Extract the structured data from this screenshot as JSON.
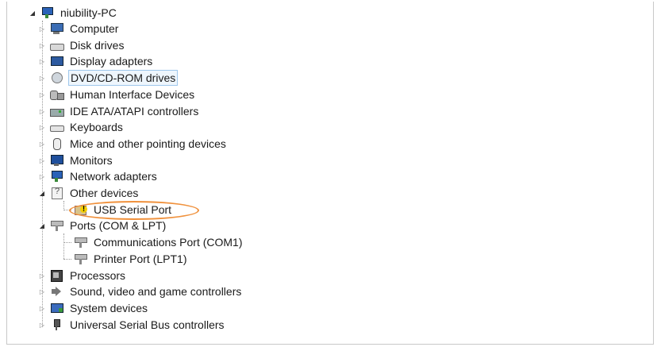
{
  "root": {
    "label": "niubility-PC",
    "icon": "computer-network-icon",
    "expanded": true
  },
  "categories": [
    {
      "id": "computer",
      "label": "Computer",
      "icon": "computer-icon",
      "expanded": false
    },
    {
      "id": "disk-drives",
      "label": "Disk drives",
      "icon": "disk-drive-icon",
      "expanded": false
    },
    {
      "id": "display-adapters",
      "label": "Display adapters",
      "icon": "display-adapter-icon",
      "expanded": false
    },
    {
      "id": "dvd-cd-rom-drives",
      "label": "DVD/CD-ROM drives",
      "icon": "dvd-drive-icon",
      "expanded": false,
      "selected": true
    },
    {
      "id": "human-interface-devices",
      "label": "Human Interface Devices",
      "icon": "hid-icon",
      "expanded": false
    },
    {
      "id": "ide-ata-atapi-controllers",
      "label": "IDE ATA/ATAPI controllers",
      "icon": "ide-controller-icon",
      "expanded": false
    },
    {
      "id": "keyboards",
      "label": "Keyboards",
      "icon": "keyboard-icon",
      "expanded": false
    },
    {
      "id": "mice",
      "label": "Mice and other pointing devices",
      "icon": "mouse-icon",
      "expanded": false
    },
    {
      "id": "monitors",
      "label": "Monitors",
      "icon": "monitor-icon",
      "expanded": false
    },
    {
      "id": "network-adapters",
      "label": "Network adapters",
      "icon": "network-adapter-icon",
      "expanded": false
    },
    {
      "id": "other-devices",
      "label": "Other devices",
      "icon": "unknown-device-icon",
      "expanded": true,
      "children": [
        {
          "label": "USB Serial Port",
          "icon": "usb-serial-warning-icon",
          "highlighted": true
        }
      ]
    },
    {
      "id": "ports",
      "label": "Ports (COM & LPT)",
      "icon": "port-icon",
      "expanded": true,
      "children": [
        {
          "label": "Communications Port (COM1)",
          "icon": "port-icon"
        },
        {
          "label": "Printer Port (LPT1)",
          "icon": "port-icon"
        }
      ]
    },
    {
      "id": "processors",
      "label": "Processors",
      "icon": "processor-icon",
      "expanded": false
    },
    {
      "id": "sound",
      "label": "Sound, video and game controllers",
      "icon": "speaker-icon",
      "expanded": false
    },
    {
      "id": "system-devices",
      "label": "System devices",
      "icon": "system-device-icon",
      "expanded": false
    },
    {
      "id": "usb-controllers",
      "label": "Universal Serial Bus controllers",
      "icon": "usb-connector-icon",
      "expanded": false
    }
  ],
  "colors": {
    "highlight_ring": "#f0913c",
    "selection_border": "#9ec7ec",
    "selection_fill": "#eef6fd"
  }
}
